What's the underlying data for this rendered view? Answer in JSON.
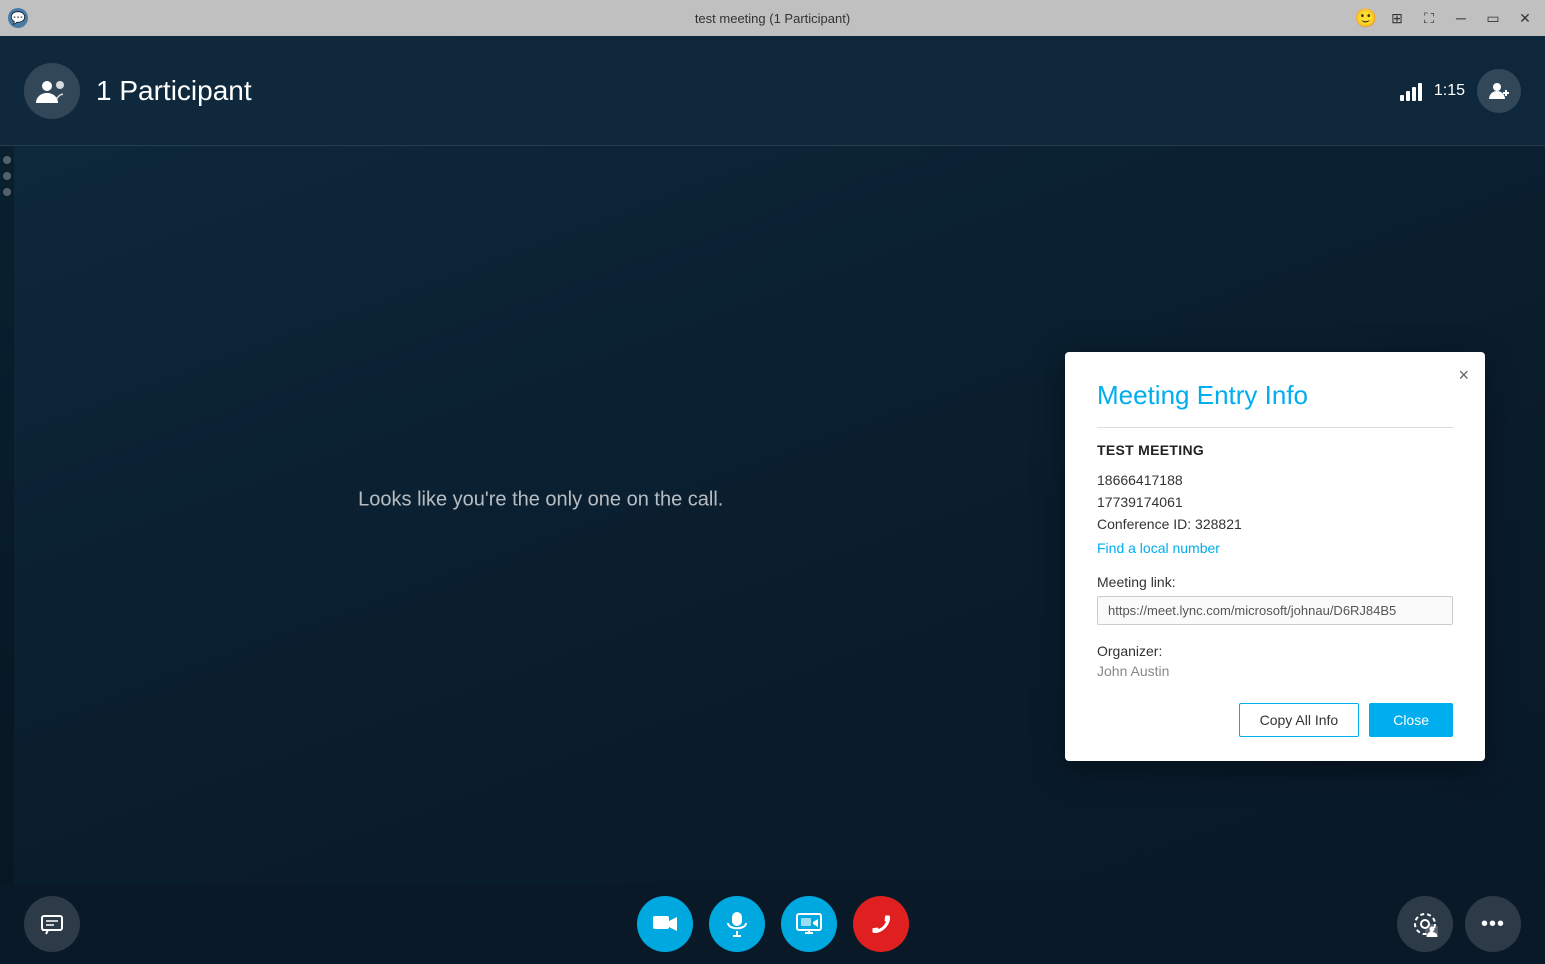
{
  "titleBar": {
    "title": "test meeting (1 Participant)",
    "icon": "💬"
  },
  "topBar": {
    "participantCount": "1 Participant",
    "timer": "1:15"
  },
  "centerMessage": "Looks like you're the only one on the call.",
  "bottomBar": {
    "chatLabel": "💬",
    "videoLabel": "🎥",
    "micLabel": "🎤",
    "screenLabel": "🖥",
    "hangupLabel": "📞",
    "settingsLabel": "⚙",
    "moreLabel": "•••"
  },
  "modal": {
    "title": "Meeting Entry Info",
    "closeLabel": "×",
    "meetingName": "TEST MEETING",
    "phone1": "18666417188",
    "phone2": "17739174061",
    "conferenceId": "Conference ID: 328821",
    "findLocalLabel": "Find a local number",
    "meetingLinkLabel": "Meeting link:",
    "meetingLinkUrl": "https://meet.lync.com/microsoft/johnau/D6RJ84B5",
    "organizerLabel": "Organizer:",
    "organizerName": "John Austin",
    "copyAllLabel": "Copy All Info",
    "closeButtonLabel": "Close"
  },
  "colors": {
    "accent": "#00adef",
    "hangup": "#e02020",
    "ctrlBtn": "#00a8e0"
  }
}
